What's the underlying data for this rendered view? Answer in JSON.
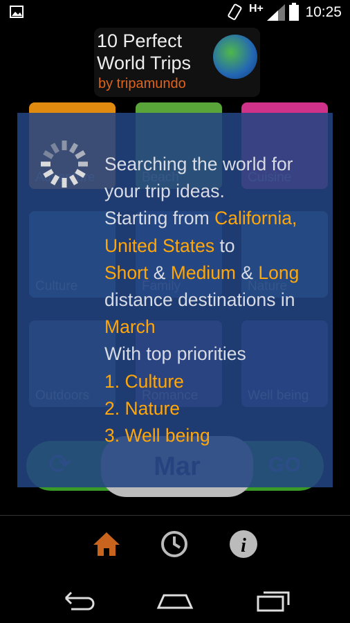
{
  "status_bar": {
    "network": "H+",
    "time": "10:25",
    "icons": [
      "image-icon",
      "vibrate-icon",
      "signal-icon",
      "battery-icon"
    ]
  },
  "logo": {
    "line1": "10 Perfect",
    "line2": "World Trips",
    "line3": "by tripamundo"
  },
  "tiles": [
    {
      "label": "Adventure",
      "color": "#e08a10"
    },
    {
      "label": "Beach",
      "color": "#5aa53a"
    },
    {
      "label": "Cuisine",
      "color": "#d0328a"
    },
    {
      "label": "Culture",
      "color": "#2a6a8a"
    },
    {
      "label": "Family",
      "color": "#2a5a8a"
    },
    {
      "label": "Nature",
      "color": "#2a6a8a"
    },
    {
      "label": "Outdoors",
      "color": "#3a5a6a"
    },
    {
      "label": "Romance",
      "color": "#5a3a7a"
    },
    {
      "label": "Well being",
      "color": "#4a3a7a"
    }
  ],
  "bottom": {
    "month": "Mar",
    "go": "GO"
  },
  "dialog": {
    "line1": "Searching the world for your trip ideas.",
    "starting_from": "Starting from ",
    "origin": "California, United States",
    "to": " to",
    "short": "Short",
    "amp": " & ",
    "medium": "Medium",
    "long": "Long",
    "distance": "distance destinations in",
    "month": "March",
    "priorities_label": "With top priorities",
    "priorities": [
      "1. Culture",
      "2. Nature",
      "3. Well being"
    ]
  },
  "nav": [
    "home-icon",
    "history-icon",
    "info-icon"
  ],
  "colors": {
    "accent": "#ffa70a",
    "overlay": "#234482",
    "home": "#c8641e"
  }
}
